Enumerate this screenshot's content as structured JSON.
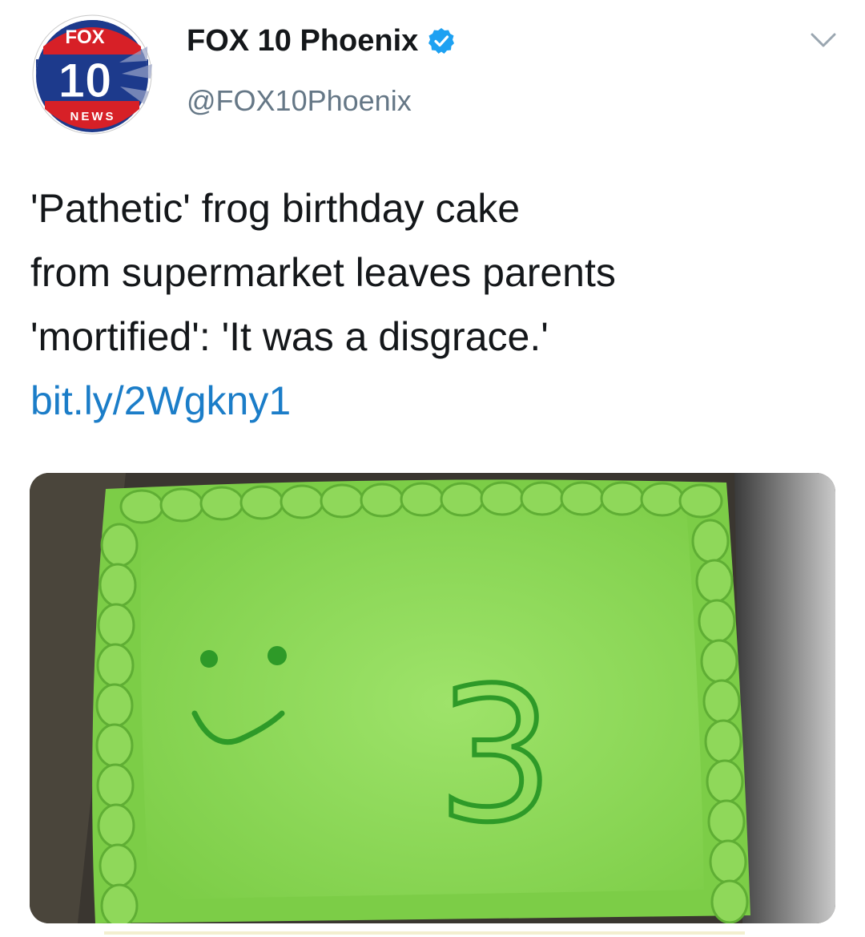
{
  "account": {
    "display_name": "FOX 10 Phoenix",
    "handle": "@FOX10Phoenix",
    "verified_icon": "verified-badge-icon",
    "menu_icon": "chevron-down-icon",
    "avatar_logo_text": {
      "top": "FOX",
      "number": "10",
      "bottom": "NEWS"
    }
  },
  "tweet": {
    "lines": [
      "'Pathetic' frog birthday cake",
      "from supermarket leaves parents",
      "'mortified': 'It was a disgrace.'"
    ],
    "link": "bit.ly/2Wgkny1"
  },
  "media": {
    "cake_number_text": "3"
  },
  "colors": {
    "link": "#1b7dc8",
    "verified": "#1da1f2",
    "handle": "#657786",
    "frosting": "#8fd85a",
    "piping": "#2e9a28"
  }
}
